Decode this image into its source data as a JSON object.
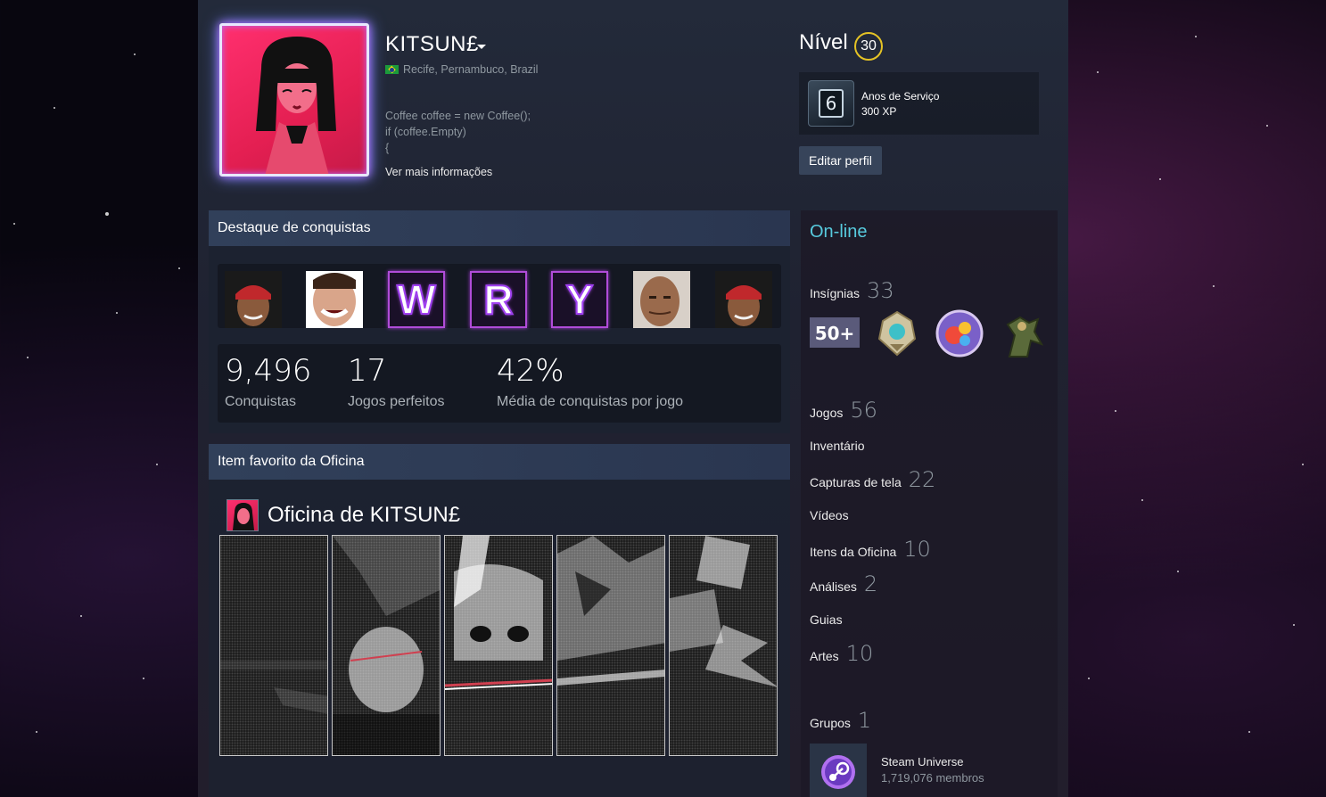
{
  "profile": {
    "persona_name": "KITSUN£",
    "location": "Recife, Pernambuco, Brazil",
    "summary_lines": [
      "Coffee coffee = new Coffee();",
      "if (coffee.Empty)",
      "{"
    ],
    "more_info_label": "Ver mais informações"
  },
  "level": {
    "label": "Nível",
    "value": "30",
    "service_badge_number": "6",
    "service_title": "Anos de Serviço",
    "service_xp": "300 XP",
    "edit_profile_label": "Editar perfil"
  },
  "achievements": {
    "header": "Destaque de conquistas",
    "letters": [
      "W",
      "R",
      "Y"
    ],
    "stats": [
      {
        "value": "9,496",
        "label": "Conquistas"
      },
      {
        "value": "17",
        "label": "Jogos perfeitos"
      },
      {
        "value": "42%",
        "label": "Média de conquistas por jogo"
      }
    ]
  },
  "workshop": {
    "header": "Item favorito da Oficina",
    "title": "Oficina de KITSUN£"
  },
  "sidebar": {
    "status": "On-line",
    "badges_label": "Insígnias",
    "badges_count": "33",
    "badge_50_text": "50+",
    "links": [
      {
        "label": "Jogos",
        "count": "56"
      },
      {
        "label": "Inventário",
        "count": ""
      },
      {
        "label": "Capturas de tela",
        "count": "22"
      },
      {
        "label": "Vídeos",
        "count": ""
      },
      {
        "label": "Itens da Oficina",
        "count": "10"
      },
      {
        "label": "Análises",
        "count": "2"
      },
      {
        "label": "Guias",
        "count": ""
      },
      {
        "label": "Artes",
        "count": "10"
      }
    ],
    "groups_label": "Grupos",
    "groups_count": "1",
    "group": {
      "name": "Steam Universe",
      "members": "1,719,076 membros"
    }
  },
  "colors": {
    "online": "#57cbde",
    "level_ring": "#e5c325",
    "neon_border": "#b04cd8"
  }
}
